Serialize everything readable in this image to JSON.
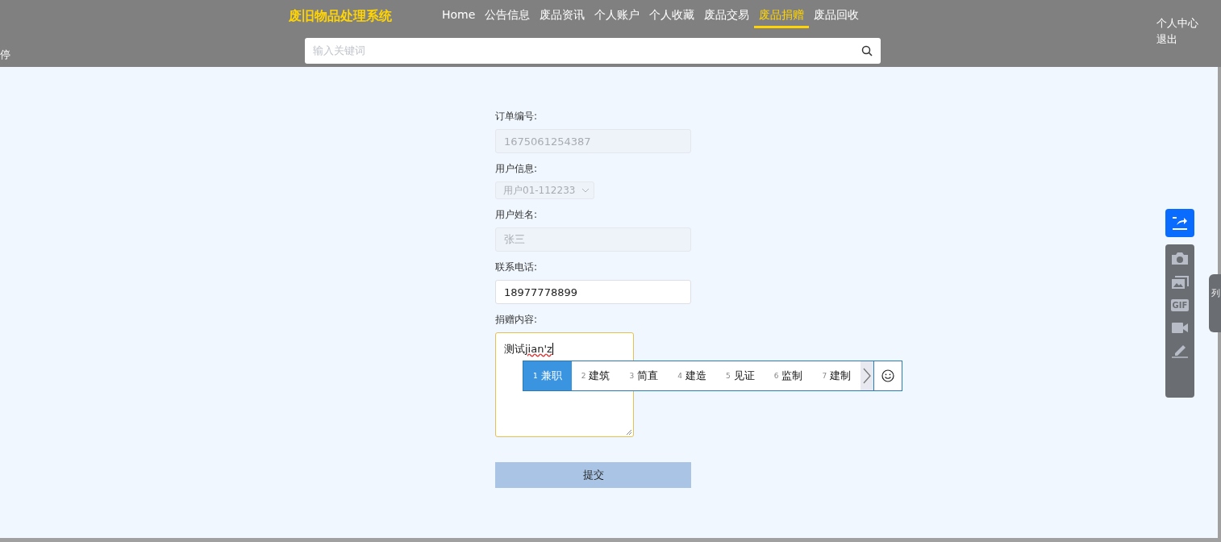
{
  "header": {
    "edge_text": "停",
    "logo": "废旧物品处理系统",
    "nav": [
      {
        "label": "Home",
        "selected": false
      },
      {
        "label": "公告信息",
        "selected": false
      },
      {
        "label": "废品资讯",
        "selected": false
      },
      {
        "label": "个人账户",
        "selected": false
      },
      {
        "label": "个人收藏",
        "selected": false
      },
      {
        "label": "废品交易",
        "selected": false
      },
      {
        "label": "废品捐赠",
        "selected": true
      },
      {
        "label": "废品回收",
        "selected": false
      }
    ],
    "search": {
      "placeholder": "输入关键词"
    },
    "user_links": [
      "个人中心",
      "退出"
    ]
  },
  "form": {
    "fields": [
      {
        "label": "订单编号:",
        "kind": "input",
        "value": "1675061254387",
        "disabled": true
      },
      {
        "label": "用户信息:",
        "kind": "select",
        "value": "用户01-112233",
        "disabled": true
      },
      {
        "label": "用户姓名:",
        "kind": "input",
        "value": "张三",
        "disabled": true
      },
      {
        "label": "联系电话:",
        "kind": "input",
        "value": "18977778899",
        "disabled": false
      },
      {
        "label": "捐赠内容:",
        "kind": "textarea",
        "value": "测试",
        "composition": "jian'z",
        "disabled": false
      }
    ],
    "submit": "提交"
  },
  "ime": {
    "candidates": [
      {
        "index": "1",
        "text": "兼职",
        "selected": true
      },
      {
        "index": "2",
        "text": "建筑",
        "selected": false
      },
      {
        "index": "3",
        "text": "简直",
        "selected": false
      },
      {
        "index": "4",
        "text": "建造",
        "selected": false
      },
      {
        "index": "5",
        "text": "见证",
        "selected": false
      },
      {
        "index": "6",
        "text": "监制",
        "selected": false
      },
      {
        "index": "7",
        "text": "建制",
        "selected": false
      }
    ]
  },
  "side_toolbar": {
    "gif_label": "GIF"
  },
  "side_tab": {
    "label": "列"
  }
}
